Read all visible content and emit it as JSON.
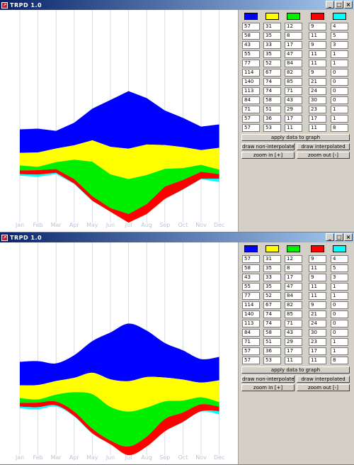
{
  "window": {
    "title": "TRPD 1.0",
    "controls": [
      "_",
      "□",
      "×"
    ]
  },
  "panel": {
    "series_colors": [
      "#0000ff",
      "#ffff00",
      "#00ee00",
      "#ff0000",
      "#00ffff"
    ],
    "table": [
      [
        "57",
        "31",
        "12",
        "9",
        "4"
      ],
      [
        "58",
        "35",
        "8",
        "11",
        "5"
      ],
      [
        "43",
        "33",
        "17",
        "9",
        "3"
      ],
      [
        "55",
        "35",
        "47",
        "11",
        "1"
      ],
      [
        "77",
        "52",
        "84",
        "11",
        "1"
      ],
      [
        "114",
        "67",
        "82",
        "9",
        "0"
      ],
      [
        "140",
        "74",
        "85",
        "21",
        "0"
      ],
      [
        "113",
        "74",
        "71",
        "24",
        "0"
      ],
      [
        "84",
        "58",
        "43",
        "30",
        "0"
      ],
      [
        "71",
        "51",
        "29",
        "23",
        "1"
      ],
      [
        "57",
        "36",
        "17",
        "17",
        "1"
      ],
      [
        "57",
        "53",
        "11",
        "11",
        "8"
      ]
    ],
    "buttons": {
      "apply": "apply data to graph",
      "draw_non_interpolated": "draw non-interpolated",
      "draw_interpolated": "draw interpolated",
      "zoom_in": "zoom in [+]",
      "zoom_out": "zoom out [-]"
    }
  },
  "chart_data": [
    {
      "type": "area",
      "style": "streamgraph, non-interpolated",
      "categories": [
        "Jan",
        "Feb",
        "Mar",
        "Apr",
        "May",
        "Jun",
        "Jul",
        "Aug",
        "Sep",
        "Oct",
        "Nov",
        "Dec"
      ],
      "series": [
        {
          "color": "#0000ff",
          "values": [
            57,
            58,
            43,
            55,
            77,
            114,
            140,
            113,
            84,
            71,
            57,
            57
          ]
        },
        {
          "color": "#ffff00",
          "values": [
            31,
            35,
            33,
            35,
            52,
            67,
            74,
            74,
            58,
            51,
            36,
            53
          ]
        },
        {
          "color": "#00ee00",
          "values": [
            12,
            8,
            17,
            47,
            84,
            82,
            85,
            71,
            43,
            29,
            17,
            11
          ]
        },
        {
          "color": "#ff0000",
          "values": [
            9,
            11,
            9,
            11,
            11,
            9,
            21,
            24,
            30,
            23,
            17,
            11
          ]
        },
        {
          "color": "#00ffff",
          "values": [
            4,
            5,
            3,
            1,
            1,
            0,
            0,
            0,
            0,
            1,
            1,
            8
          ]
        }
      ],
      "grid": true
    },
    {
      "type": "area",
      "style": "streamgraph, interpolated",
      "categories": [
        "Jan",
        "Feb",
        "Mar",
        "Apr",
        "May",
        "Jun",
        "Jul",
        "Aug",
        "Sep",
        "Oct",
        "Nov",
        "Dec"
      ],
      "series": [
        {
          "color": "#0000ff",
          "values": [
            57,
            58,
            43,
            55,
            77,
            114,
            140,
            113,
            84,
            71,
            57,
            57
          ]
        },
        {
          "color": "#ffff00",
          "values": [
            31,
            35,
            33,
            35,
            52,
            67,
            74,
            74,
            58,
            51,
            36,
            53
          ]
        },
        {
          "color": "#00ee00",
          "values": [
            12,
            8,
            17,
            47,
            84,
            82,
            85,
            71,
            43,
            29,
            17,
            11
          ]
        },
        {
          "color": "#ff0000",
          "values": [
            9,
            11,
            9,
            11,
            11,
            9,
            21,
            24,
            30,
            23,
            17,
            11
          ]
        },
        {
          "color": "#00ffff",
          "values": [
            4,
            5,
            3,
            1,
            1,
            0,
            0,
            0,
            0,
            1,
            1,
            8
          ]
        }
      ],
      "grid": true
    }
  ]
}
